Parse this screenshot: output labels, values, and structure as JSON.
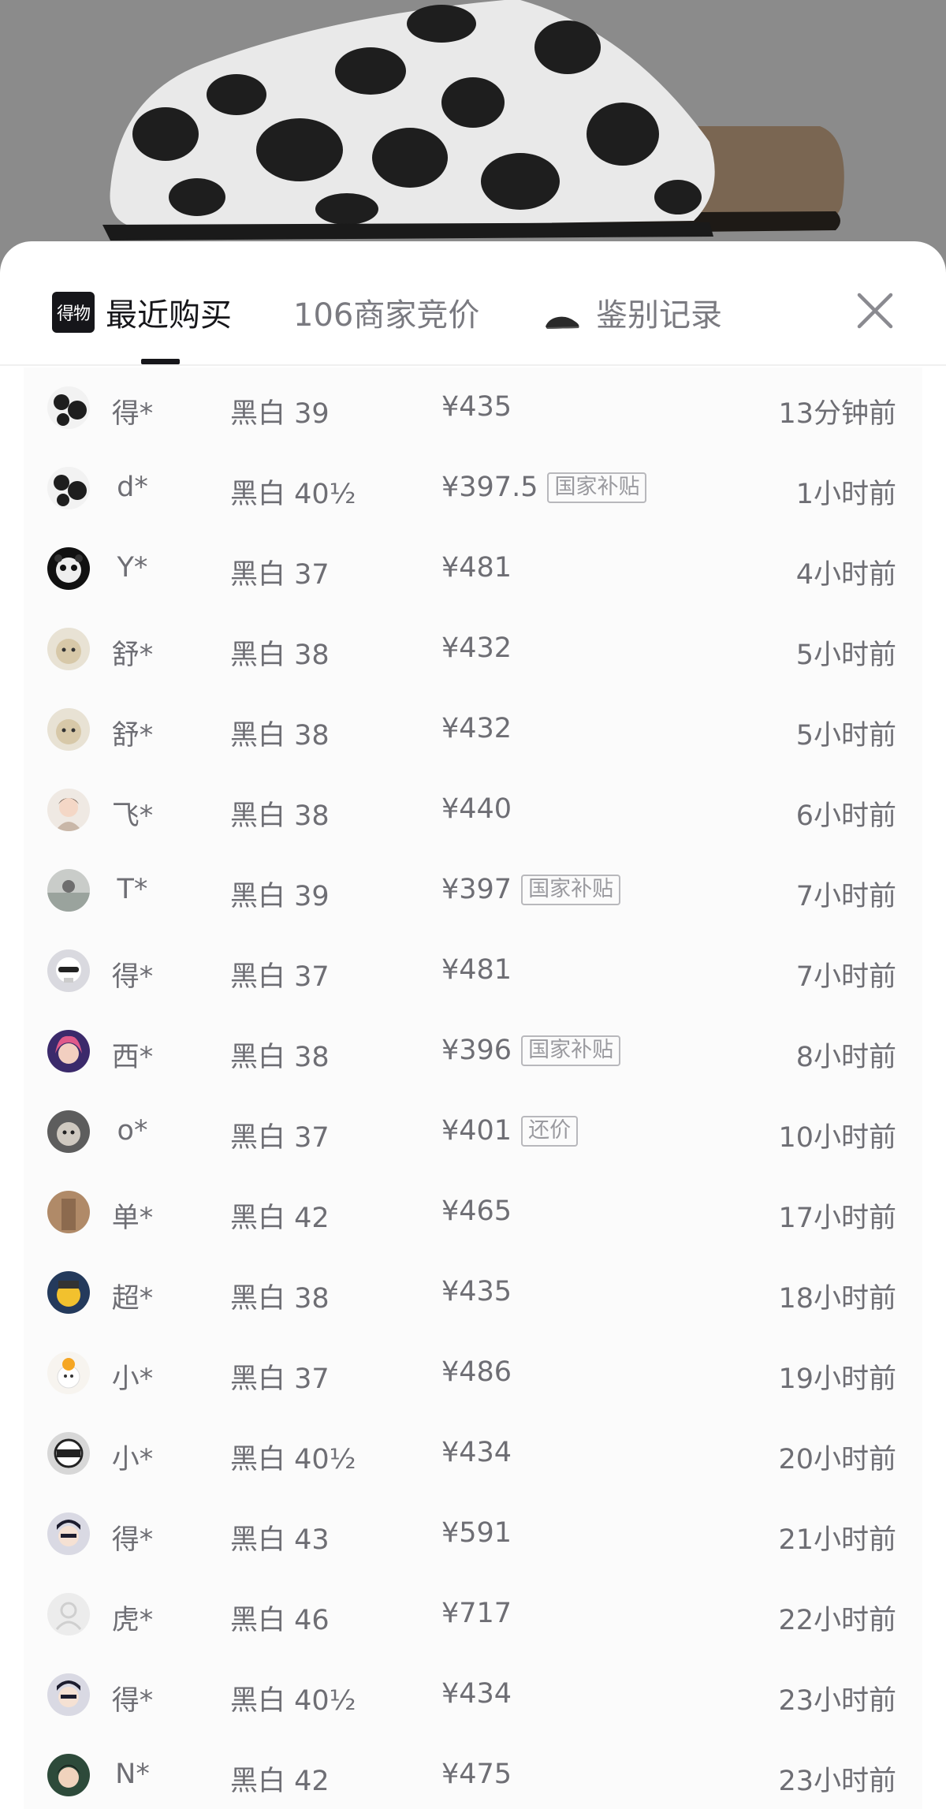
{
  "tabs": [
    {
      "label": "最近购买",
      "active": true,
      "icon": "dewu-logo-icon",
      "logo_text": "得物"
    },
    {
      "label": "106商家竞价",
      "active": false
    },
    {
      "label": "鉴别记录",
      "active": false,
      "icon": "shoe-icon"
    }
  ],
  "close_icon": "close-icon",
  "badge_color": "#b8b8bc",
  "purchases": [
    {
      "user": "得*",
      "spec": "黑白 39",
      "price": "¥435",
      "badge": "",
      "time": "13分钟前",
      "avatar": "cow-avatar"
    },
    {
      "user": "d*",
      "spec": "黑白 40½",
      "price": "¥397.5",
      "badge": "国家补贴",
      "time": "1小时前",
      "avatar": "cow-avatar"
    },
    {
      "user": "Y*",
      "spec": "黑白 37",
      "price": "¥481",
      "badge": "",
      "time": "4小时前",
      "avatar": "panda-avatar"
    },
    {
      "user": "舒*",
      "spec": "黑白 38",
      "price": "¥432",
      "badge": "",
      "time": "5小时前",
      "avatar": "cat-avatar"
    },
    {
      "user": "舒*",
      "spec": "黑白 38",
      "price": "¥432",
      "badge": "",
      "time": "5小时前",
      "avatar": "cat-avatar"
    },
    {
      "user": "飞*",
      "spec": "黑白 38",
      "price": "¥440",
      "badge": "",
      "time": "6小时前",
      "avatar": "girl-avatar"
    },
    {
      "user": "T*",
      "spec": "黑白 39",
      "price": "¥397",
      "badge": "国家补贴",
      "time": "7小时前",
      "avatar": "photo-avatar"
    },
    {
      "user": "得*",
      "spec": "黑白 37",
      "price": "¥481",
      "badge": "",
      "time": "7小时前",
      "avatar": "skull-avatar"
    },
    {
      "user": "西*",
      "spec": "黑白 38",
      "price": "¥396",
      "badge": "国家补贴",
      "time": "8小时前",
      "avatar": "anime-avatar"
    },
    {
      "user": "o*",
      "spec": "黑白 37",
      "price": "¥401",
      "badge": "还价",
      "time": "10小时前",
      "avatar": "dog-avatar"
    },
    {
      "user": "单*",
      "spec": "黑白 42",
      "price": "¥465",
      "badge": "",
      "time": "17小时前",
      "avatar": "brown-avatar"
    },
    {
      "user": "超*",
      "spec": "黑白 38",
      "price": "¥435",
      "badge": "",
      "time": "18小时前",
      "avatar": "yellow-avatar"
    },
    {
      "user": "小*",
      "spec": "黑白 37",
      "price": "¥486",
      "badge": "",
      "time": "19小时前",
      "avatar": "bear-avatar"
    },
    {
      "user": "小*",
      "spec": "黑白 40½",
      "price": "¥434",
      "badge": "",
      "time": "20小时前",
      "avatar": "helmet-avatar"
    },
    {
      "user": "得*",
      "spec": "黑白 43",
      "price": "¥591",
      "badge": "",
      "time": "21小时前",
      "avatar": "cartoon-avatar"
    },
    {
      "user": "虎*",
      "spec": "黑白 46",
      "price": "¥717",
      "badge": "",
      "time": "22小时前",
      "avatar": "default-avatar"
    },
    {
      "user": "得*",
      "spec": "黑白 40½",
      "price": "¥434",
      "badge": "",
      "time": "23小时前",
      "avatar": "cartoon-avatar"
    },
    {
      "user": "N*",
      "spec": "黑白 42",
      "price": "¥475",
      "badge": "",
      "time": "23小时前",
      "avatar": "boy-avatar"
    }
  ]
}
